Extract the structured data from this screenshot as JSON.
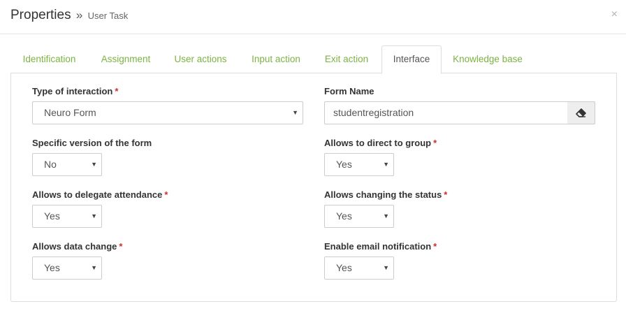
{
  "header": {
    "title": "Properties",
    "separator": "»",
    "subtitle": "User Task",
    "close_icon": "×"
  },
  "tabs": [
    {
      "label": "Identification",
      "active": false
    },
    {
      "label": "Assignment",
      "active": false
    },
    {
      "label": "User actions",
      "active": false
    },
    {
      "label": "Input action",
      "active": false
    },
    {
      "label": "Exit action",
      "active": false
    },
    {
      "label": "Interface",
      "active": true
    },
    {
      "label": "Knowledge base",
      "active": false
    }
  ],
  "form": {
    "type_of_interaction": {
      "label": "Type of interaction",
      "required": "*",
      "value": "Neuro Form"
    },
    "form_name": {
      "label": "Form Name",
      "value": "studentregistration",
      "clear_icon": "eraser-icon"
    },
    "specific_version": {
      "label": "Specific version of the form",
      "value": "No"
    },
    "direct_to_group": {
      "label": "Allows to direct to group",
      "required": "*",
      "value": "Yes"
    },
    "delegate_attendance": {
      "label": "Allows to delegate attendance",
      "required": "*",
      "value": "Yes"
    },
    "changing_status": {
      "label": "Allows changing the status",
      "required": "*",
      "value": "Yes"
    },
    "data_change": {
      "label": "Allows data change",
      "required": "*",
      "value": "Yes"
    },
    "email_notification": {
      "label": "Enable email notification",
      "required": "*",
      "value": "Yes"
    },
    "caret": "▼"
  },
  "colors": {
    "tab_link": "#7cb342",
    "required": "#c9302c",
    "border": "#dddddd"
  }
}
